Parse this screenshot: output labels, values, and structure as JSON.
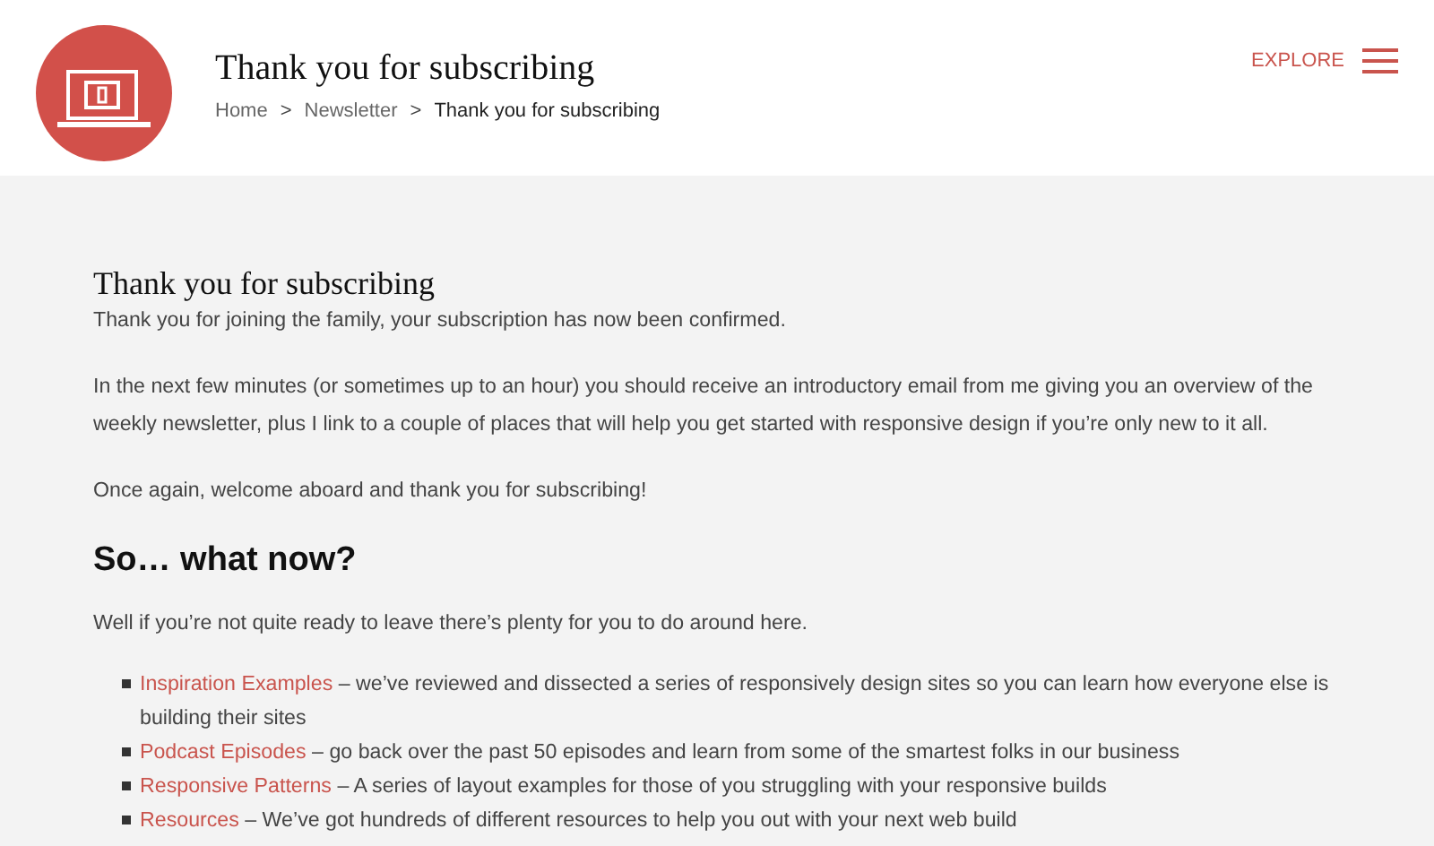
{
  "header": {
    "title": "Thank you for subscribing",
    "breadcrumb": [
      {
        "label": "Home",
        "kind": "link"
      },
      {
        "label": ">",
        "kind": "separator"
      },
      {
        "label": "Newsletter",
        "kind": "link"
      },
      {
        "label": ">",
        "kind": "separator"
      },
      {
        "label": "Thank you for subscribing",
        "kind": "current"
      }
    ],
    "explore": "EXPLORE"
  },
  "content": {
    "heading": "Thank you for subscribing",
    "paragraphs": [
      "Thank you for joining the family, your subscription has now been confirmed.",
      "In the next few minutes (or sometimes up to an hour) you should receive an introductory email from me giving you an overview of the weekly newsletter, plus I link to a couple of places that will help you get started with responsive design if you’re only new to it all.",
      "Once again, welcome aboard and thank you for subscribing!"
    ],
    "subheading": "So… what now?",
    "intro": "Well if you’re not quite ready to leave there’s plenty for you to do around here.",
    "list": [
      {
        "link": "Inspiration Examples",
        "text": " – we’ve reviewed and dissected a series of responsively design sites so you can learn how everyone else is building their sites"
      },
      {
        "link": "Podcast Episodes",
        "text": " – go back over the past 50 episodes and learn from some of the smartest folks in our business"
      },
      {
        "link": "Responsive Patterns",
        "text": " – A series of layout examples for those of you struggling with your responsive builds"
      },
      {
        "link": "Resources",
        "text": " – We’ve got hundreds of different resources to help you out with your next web build"
      }
    ]
  }
}
